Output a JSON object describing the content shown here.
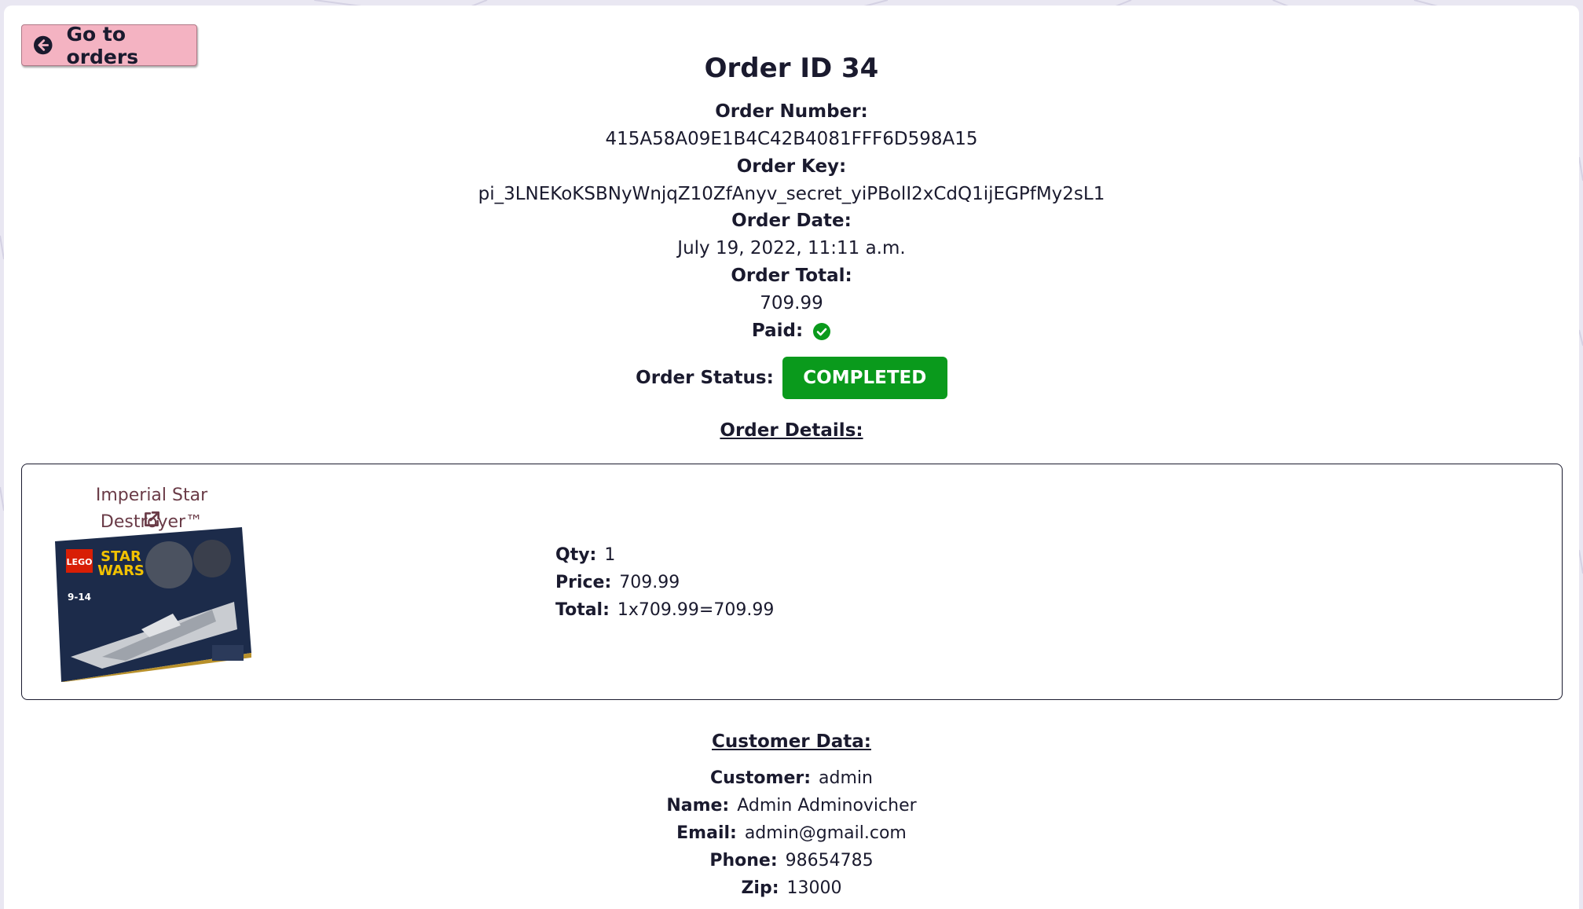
{
  "nav": {
    "back_label": "Go to orders"
  },
  "order": {
    "title": "Order ID 34",
    "number_label": "Order Number:",
    "number": "415A58A09E1B4C42B4081FFF6D598A15",
    "key_label": "Order Key:",
    "key": "pi_3LNEKoKSBNyWnjqZ10ZfAnyv_secret_yiPBolI2xCdQ1ijEGPfMy2sL1",
    "date_label": "Order Date:",
    "date": "July 19, 2022, 11:11 a.m.",
    "total_label": "Order Total:",
    "total": "709.99",
    "paid_label": "Paid:",
    "status_label": "Order Status:",
    "status": "COMPLETED"
  },
  "details": {
    "heading": "Order Details:",
    "items": [
      {
        "name": "Imperial Star Destroyer™",
        "qty_label": "Qty:",
        "qty": "1",
        "price_label": "Price:",
        "price": "709.99",
        "total_label": "Total:",
        "total": "1x709.99=709.99"
      }
    ]
  },
  "customer": {
    "heading": "Customer Data:",
    "customer_label": "Customer:",
    "customer": "admin",
    "name_label": "Name:",
    "name": "Admin Adminovicher",
    "email_label": "Email:",
    "email": "admin@gmail.com",
    "phone_label": "Phone:",
    "phone": "98654785",
    "zip_label": "Zip:",
    "zip": "13000"
  },
  "icons": {
    "back": "arrow-circle-left-icon",
    "paid": "check-circle-icon",
    "external": "external-link-icon"
  },
  "colors": {
    "back_button": "#f4b3c2",
    "status_completed": "#0a9a1c",
    "paid_check": "#0a9a1c",
    "product_link": "#6a3b47"
  }
}
